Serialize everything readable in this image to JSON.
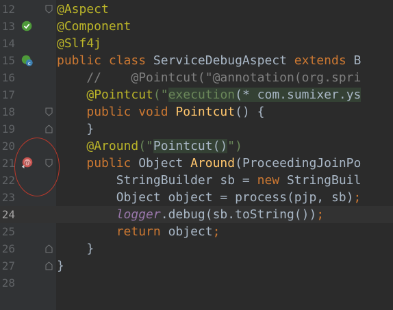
{
  "editor": {
    "current_line": 24,
    "lines": [
      {
        "num": "12",
        "tokens": [
          {
            "t": "@Aspect",
            "c": "ann"
          }
        ]
      },
      {
        "num": "13",
        "tokens": [
          {
            "t": "@Component",
            "c": "ann"
          }
        ]
      },
      {
        "num": "14",
        "tokens": [
          {
            "t": "@Slf4j",
            "c": "ann"
          }
        ]
      },
      {
        "num": "15",
        "tokens": [
          {
            "t": "public class ",
            "c": "kw"
          },
          {
            "t": "ServiceDebugAspect ",
            "c": ""
          },
          {
            "t": "extends ",
            "c": "kw"
          },
          {
            "t": "B",
            "c": ""
          }
        ]
      },
      {
        "num": "16",
        "tokens": [
          {
            "t": "    //    @Pointcut(\"@annotation(org.spri",
            "c": "cmt"
          }
        ]
      },
      {
        "num": "17",
        "tokens": [
          {
            "t": "    ",
            "c": ""
          },
          {
            "t": "@Pointcut",
            "c": "ann"
          },
          {
            "t": "(\"",
            "c": "str"
          },
          {
            "t": "execution",
            "c": "str hl"
          },
          {
            "t": "(* com.sumixer.ys",
            "c": "hl"
          }
        ]
      },
      {
        "num": "18",
        "tokens": [
          {
            "t": "    ",
            "c": ""
          },
          {
            "t": "public void ",
            "c": "kw"
          },
          {
            "t": "Pointcut",
            "c": "fn"
          },
          {
            "t": "() {",
            "c": ""
          }
        ]
      },
      {
        "num": "19",
        "tokens": [
          {
            "t": "    }",
            "c": ""
          }
        ]
      },
      {
        "num": "20",
        "tokens": [
          {
            "t": "    ",
            "c": ""
          },
          {
            "t": "@Around",
            "c": "ann"
          },
          {
            "t": "(\"",
            "c": "str"
          },
          {
            "t": "Pointcut()",
            "c": "hl"
          },
          {
            "t": "\")",
            "c": "str"
          }
        ]
      },
      {
        "num": "21",
        "tokens": [
          {
            "t": "    ",
            "c": ""
          },
          {
            "t": "public ",
            "c": "kw"
          },
          {
            "t": "Object ",
            "c": ""
          },
          {
            "t": "Around",
            "c": "fn"
          },
          {
            "t": "(ProceedingJoinPo",
            "c": ""
          }
        ]
      },
      {
        "num": "22",
        "tokens": [
          {
            "t": "        StringBuilder sb = ",
            "c": ""
          },
          {
            "t": "new ",
            "c": "kw"
          },
          {
            "t": "StringBuil",
            "c": ""
          }
        ]
      },
      {
        "num": "23",
        "tokens": [
          {
            "t": "        Object object = process(pjp, sb)",
            "c": ""
          },
          {
            "t": ";",
            "c": "kw"
          }
        ]
      },
      {
        "num": "24",
        "tokens": [
          {
            "t": "        ",
            "c": ""
          },
          {
            "t": "logger",
            "c": "field"
          },
          {
            "t": ".debug(sb.toString())",
            "c": ""
          },
          {
            "t": ";",
            "c": "kw"
          }
        ]
      },
      {
        "num": "25",
        "tokens": [
          {
            "t": "        ",
            "c": ""
          },
          {
            "t": "return ",
            "c": "kw"
          },
          {
            "t": "object",
            "c": ""
          },
          {
            "t": ";",
            "c": "kw"
          }
        ]
      },
      {
        "num": "26",
        "tokens": [
          {
            "t": "    }",
            "c": ""
          }
        ]
      },
      {
        "num": "27",
        "tokens": [
          {
            "t": "}",
            "c": ""
          }
        ]
      },
      {
        "num": "28",
        "tokens": []
      }
    ],
    "gutter_icons": [
      {
        "line": "13",
        "icon": "spring-bean-icon"
      },
      {
        "line": "15",
        "icon": "spring-class-icon"
      },
      {
        "line": "21",
        "icon": "aop-advice-icon"
      }
    ],
    "fold_markers": [
      {
        "line": "12",
        "type": "start"
      },
      {
        "line": "18",
        "type": "start"
      },
      {
        "line": "19",
        "type": "end"
      },
      {
        "line": "21",
        "type": "start"
      },
      {
        "line": "26",
        "type": "end"
      },
      {
        "line": "27",
        "type": "end"
      }
    ]
  }
}
